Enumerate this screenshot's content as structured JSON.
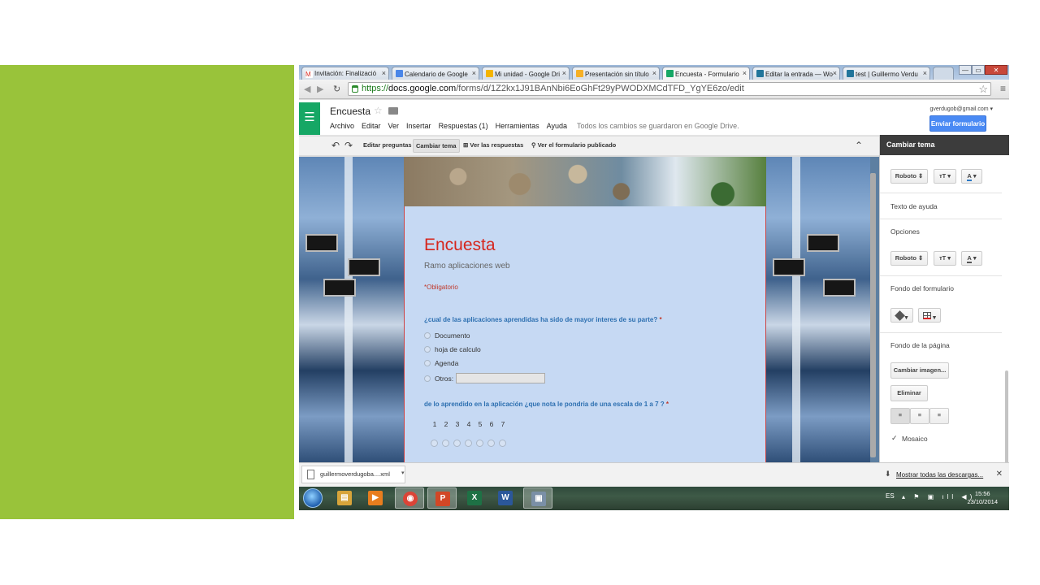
{
  "browser": {
    "tabs": [
      {
        "label": "Invitación: Finalizació",
        "icon_color": "#d93025",
        "icon_char": "M"
      },
      {
        "label": "Calendario de Google",
        "icon_color": "#4a86e8",
        "icon_char": "31"
      },
      {
        "label": "Mi unidad - Google Dri",
        "icon_color": "#f4b400",
        "icon_char": "▲"
      },
      {
        "label": "Presentación sin título",
        "icon_color": "#f6b026",
        "icon_char": "■"
      },
      {
        "label": "Encuesta - Formulario",
        "icon_color": "#16a765",
        "icon_char": "≡"
      },
      {
        "label": "Editar la entrada — Wo",
        "icon_color": "#21759b",
        "icon_char": "W"
      },
      {
        "label": "test | Guillermo Verdu",
        "icon_color": "#21759b",
        "icon_char": "W"
      }
    ],
    "window_controls": {
      "minimize": "—",
      "maximize": "▭",
      "close": "✕"
    },
    "url_scheme": "https://",
    "url_host": "docs.google.com",
    "url_path": "/forms/d/1Z2kx1J91BAnNbi6EoGhFt29yPWODXMCdTFD_YgYE6zo/edit"
  },
  "forms_header": {
    "title": "Encuesta",
    "menu": [
      "Archivo",
      "Editar",
      "Ver",
      "Insertar",
      "Respuestas (1)",
      "Herramientas",
      "Ayuda"
    ],
    "save_status": "Todos los cambios se guardaron en Google Drive.",
    "account": "gverdugob@gmail.com ▾",
    "send_button": "Enviar formulario"
  },
  "form_toolbar": {
    "edit_questions": "Editar preguntas",
    "change_theme": "Cambiar tema",
    "view_responses": "Ver las respuestas",
    "view_published": "Ver el formulario publicado"
  },
  "theme_panel": {
    "title": "Cambiar tema",
    "font_title": "Roboto",
    "help_text_label": "Texto de ayuda",
    "options_label": "Opciones",
    "font_options": "Roboto",
    "form_bg_label": "Fondo del formulario",
    "page_bg_label": "Fondo de la página",
    "change_image_button": "Cambiar imagen...",
    "delete_button": "Eliminar",
    "tile_label": "Mosaico"
  },
  "form": {
    "title": "Encuesta",
    "description": "Ramo aplicaciones web",
    "required_note": "*Obligatorio",
    "q1": {
      "title": "¿cual de las aplicaciones aprendidas ha sido de mayor interes de su parte?",
      "asterisk": "*",
      "options": [
        "Documento",
        "hoja de calculo",
        "Agenda"
      ],
      "other_label": "Otros:"
    },
    "q2": {
      "title": "de lo aprendido en la aplicación ¿que nota le pondria de una escala de 1 a 7 ?",
      "asterisk": "*",
      "scale": [
        "1",
        "2",
        "3",
        "4",
        "5",
        "6",
        "7"
      ]
    }
  },
  "download_bar": {
    "file_name": "guillermoverdugoba....xml",
    "show_all": "Mostrar todas las descargas..."
  },
  "taskbar": {
    "apps": [
      {
        "name": "explorer",
        "color": "#d8a43a",
        "glyph": "▤"
      },
      {
        "name": "media-player",
        "color": "#e87d1e",
        "glyph": "▶"
      },
      {
        "name": "chrome",
        "color": "#db4437",
        "glyph": "◉"
      },
      {
        "name": "powerpoint",
        "color": "#d24726",
        "glyph": "P"
      },
      {
        "name": "excel",
        "color": "#1e7145",
        "glyph": "X"
      },
      {
        "name": "word",
        "color": "#2b579a",
        "glyph": "W"
      },
      {
        "name": "remote-desktop",
        "color": "#7a8fa6",
        "glyph": "▣"
      }
    ],
    "language": "ES",
    "time": "15:56",
    "date": "23/10/2014"
  }
}
